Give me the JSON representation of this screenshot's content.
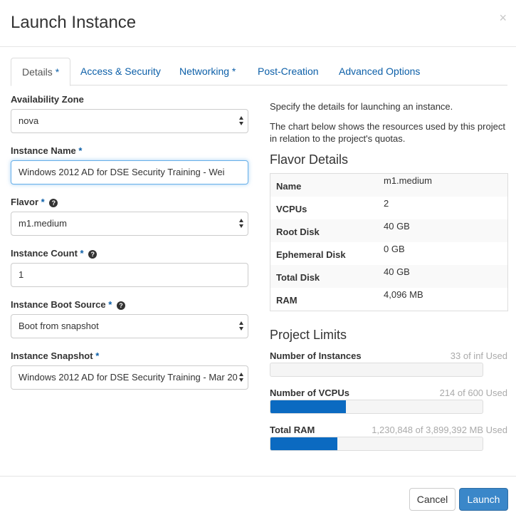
{
  "modal": {
    "title": "Launch Instance",
    "close": "×"
  },
  "tabs": [
    {
      "label": "Details",
      "required": "*"
    },
    {
      "label": "Access & Security",
      "required": ""
    },
    {
      "label": "Networking",
      "required": "*"
    },
    {
      "label": "Post-Creation",
      "required": ""
    },
    {
      "label": "Advanced Options",
      "required": ""
    }
  ],
  "form": {
    "availability_zone": {
      "label": "Availability Zone",
      "value": "nova"
    },
    "instance_name": {
      "label": "Instance Name",
      "required": "*",
      "value": "Windows 2012 AD for DSE Security Training - Wei"
    },
    "flavor": {
      "label": "Flavor",
      "required": "*",
      "value": "m1.medium"
    },
    "instance_count": {
      "label": "Instance Count",
      "required": "*",
      "value": "1"
    },
    "boot_source": {
      "label": "Instance Boot Source",
      "required": "*",
      "value": "Boot from snapshot"
    },
    "snapshot": {
      "label": "Instance Snapshot",
      "required": "*",
      "value": "Windows 2012 AD for DSE Security Training - Mar 20"
    }
  },
  "help": {
    "line1": "Specify the details for launching an instance.",
    "line2": "The chart below shows the resources used by this project in relation to the project's quotas."
  },
  "flavor_details": {
    "title": "Flavor Details",
    "rows": [
      {
        "key": "Name",
        "value": "m1.medium"
      },
      {
        "key": "VCPUs",
        "value": "2"
      },
      {
        "key": "Root Disk",
        "value": "40 GB"
      },
      {
        "key": "Ephemeral Disk",
        "value": "0 GB"
      },
      {
        "key": "Total Disk",
        "value": "40 GB"
      },
      {
        "key": "RAM",
        "value": "4,096 MB"
      }
    ]
  },
  "project_limits": {
    "title": "Project Limits",
    "items": [
      {
        "label": "Number of Instances",
        "usage": "33 of inf Used",
        "fraction": 0
      },
      {
        "label": "Number of VCPUs",
        "usage": "214 of 600 Used",
        "fraction": 0.357
      },
      {
        "label": "Total RAM",
        "usage": "1,230,848 of 3,899,392 MB Used",
        "fraction": 0.316
      }
    ]
  },
  "footer": {
    "cancel": "Cancel",
    "launch": "Launch"
  },
  "colors": {
    "link": "#0c5fa8",
    "primary_button": "#3a87c9",
    "bar_fill": "#0b6ac1"
  }
}
